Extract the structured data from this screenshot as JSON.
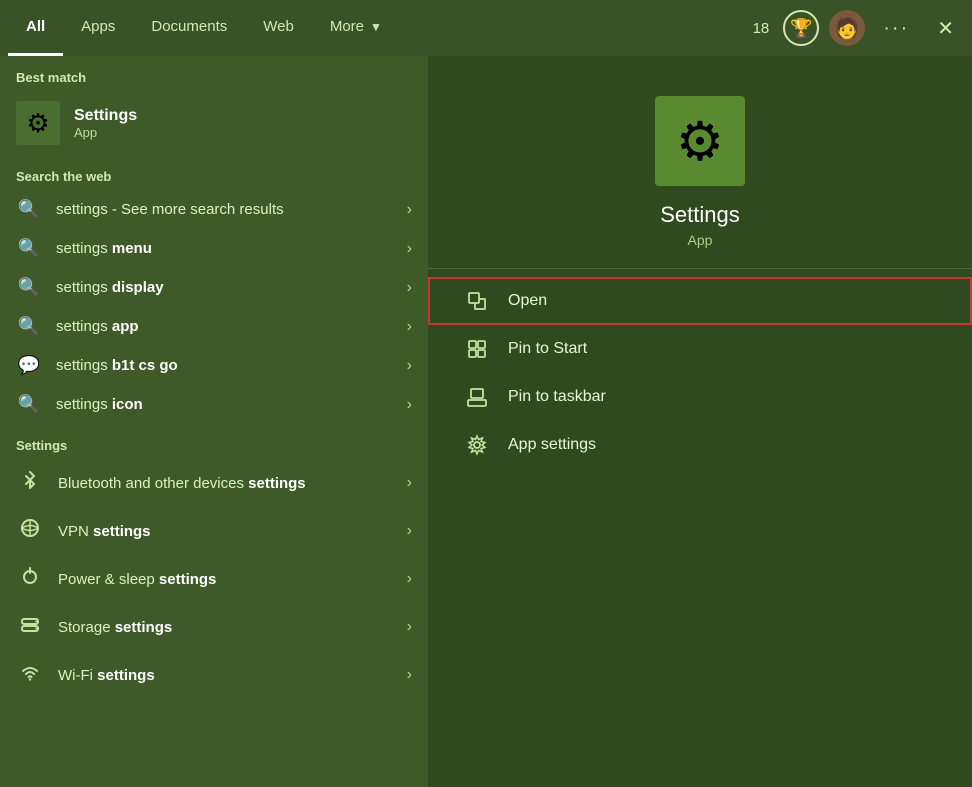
{
  "topnav": {
    "tabs": [
      {
        "id": "all",
        "label": "All",
        "active": true
      },
      {
        "id": "apps",
        "label": "Apps",
        "active": false
      },
      {
        "id": "documents",
        "label": "Documents",
        "active": false
      },
      {
        "id": "web",
        "label": "Web",
        "active": false
      },
      {
        "id": "more",
        "label": "More",
        "active": false,
        "hasDropdown": true
      }
    ],
    "badge_count": "18",
    "trophy_icon": "🏆",
    "avatar_icon": "🧑",
    "dots_label": "···",
    "close_label": "✕"
  },
  "left": {
    "best_match_label": "Best match",
    "best_match": {
      "icon": "⚙",
      "name": "Settings",
      "type": "App"
    },
    "web_section_label": "Search the web",
    "web_results": [
      {
        "icon": "🔍",
        "prefix": "settings",
        "suffix": " - See more search results",
        "bold": false
      },
      {
        "icon": "🔍",
        "prefix": "settings ",
        "bold_part": "menu",
        "suffix": ""
      },
      {
        "icon": "🔍",
        "prefix": "settings ",
        "bold_part": "display",
        "suffix": ""
      },
      {
        "icon": "🔍",
        "prefix": "settings ",
        "bold_part": "app",
        "suffix": ""
      },
      {
        "icon": "💬",
        "prefix": "settings ",
        "bold_part": "b1t cs go",
        "suffix": ""
      },
      {
        "icon": "🔍",
        "prefix": "settings ",
        "bold_part": "icon",
        "suffix": ""
      }
    ],
    "settings_section_label": "Settings",
    "settings_results": [
      {
        "icon": "📶",
        "prefix": "Bluetooth and other devices ",
        "bold_part": "settings"
      },
      {
        "icon": "🔒",
        "prefix": "VPN ",
        "bold_part": "settings"
      },
      {
        "icon": "⏰",
        "prefix": "Power & sleep ",
        "bold_part": "settings"
      },
      {
        "icon": "💾",
        "prefix": "Storage ",
        "bold_part": "settings"
      },
      {
        "icon": "📡",
        "prefix": "Wi-Fi ",
        "bold_part": "settings"
      }
    ]
  },
  "right": {
    "app_icon": "⚙",
    "app_name": "Settings",
    "app_type": "App",
    "actions": [
      {
        "id": "open",
        "icon": "↗",
        "label": "Open",
        "highlighted": true
      },
      {
        "id": "pin-start",
        "icon": "📌",
        "label": "Pin to Start",
        "highlighted": false
      },
      {
        "id": "pin-taskbar",
        "icon": "📌",
        "label": "Pin to taskbar",
        "highlighted": false
      },
      {
        "id": "app-settings",
        "icon": "⚙",
        "label": "App settings",
        "highlighted": false
      }
    ]
  }
}
